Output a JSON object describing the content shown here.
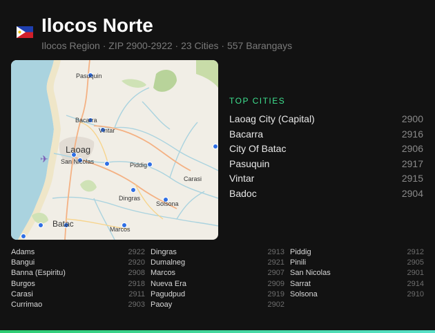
{
  "header": {
    "title": "Ilocos Norte",
    "subtitle": "Ilocos Region · ZIP 2900-2922 · 23 Cities · 557 Barangays"
  },
  "map": {
    "labels": {
      "pasuquin": "Pasuquin",
      "bacarra": "Bacarra",
      "vintar": "Vintar",
      "laoag": "Laoag",
      "san_nicolas": "San Nicolas",
      "piddig": "Piddig",
      "carasi": "Carasi",
      "dingras": "Dingras",
      "solsona": "Solsona",
      "batac": "Batac",
      "marcos": "Marcos"
    }
  },
  "top_cities": {
    "title": "TOP CITIES",
    "items": [
      {
        "name": "Laoag City (Capital)",
        "zip": "2900"
      },
      {
        "name": "Bacarra",
        "zip": "2916"
      },
      {
        "name": "City Of Batac",
        "zip": "2906"
      },
      {
        "name": "Pasuquin",
        "zip": "2917"
      },
      {
        "name": "Vintar",
        "zip": "2915"
      },
      {
        "name": "Badoc",
        "zip": "2904"
      }
    ]
  },
  "all_cities": {
    "col1": [
      {
        "name": "Adams",
        "zip": "2922"
      },
      {
        "name": "Bangui",
        "zip": "2920"
      },
      {
        "name": "Banna (Espiritu)",
        "zip": "2908"
      },
      {
        "name": "Burgos",
        "zip": "2918"
      },
      {
        "name": "Carasi",
        "zip": "2911"
      },
      {
        "name": "Currimao",
        "zip": "2903"
      }
    ],
    "col2": [
      {
        "name": "Dingras",
        "zip": "2913"
      },
      {
        "name": "Dumalneg",
        "zip": "2921"
      },
      {
        "name": "Marcos",
        "zip": "2907"
      },
      {
        "name": "Nueva Era",
        "zip": "2909"
      },
      {
        "name": "Pagudpud",
        "zip": "2919"
      },
      {
        "name": "Paoay",
        "zip": "2902"
      }
    ],
    "col3": [
      {
        "name": "Piddig",
        "zip": "2912"
      },
      {
        "name": "Pinili",
        "zip": "2905"
      },
      {
        "name": "San Nicolas",
        "zip": "2901"
      },
      {
        "name": "Sarrat",
        "zip": "2914"
      },
      {
        "name": "Solsona",
        "zip": "2910"
      }
    ]
  }
}
